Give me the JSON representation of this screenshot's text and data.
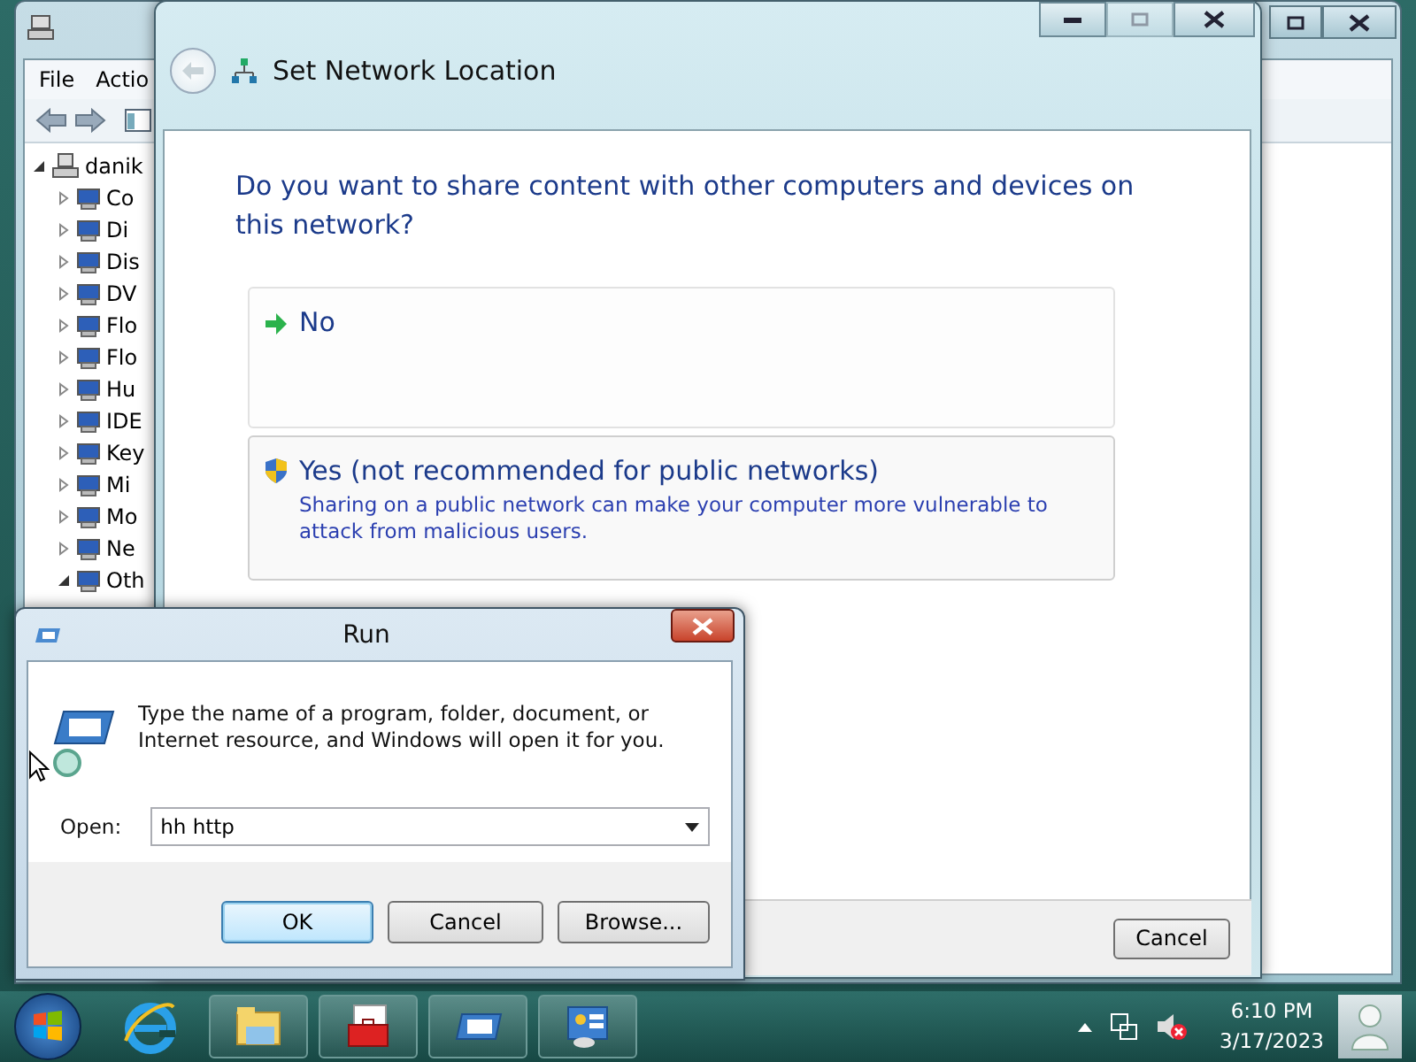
{
  "device_manager": {
    "menu": [
      "File",
      "Actio"
    ],
    "tree": {
      "label": "danik",
      "expanded": true,
      "children": [
        {
          "label": "Co",
          "expanded": false
        },
        {
          "label": "Di",
          "expanded": false
        },
        {
          "label": "Dis",
          "expanded": false
        },
        {
          "label": "DV",
          "expanded": false
        },
        {
          "label": "Flo",
          "expanded": false
        },
        {
          "label": "Flo",
          "expanded": false
        },
        {
          "label": "Hu",
          "expanded": false
        },
        {
          "label": "IDE",
          "expanded": false
        },
        {
          "label": "Key",
          "expanded": false
        },
        {
          "label": "Mi",
          "expanded": false
        },
        {
          "label": "Mo",
          "expanded": false
        },
        {
          "label": "Ne",
          "expanded": false
        },
        {
          "label": "Oth",
          "expanded": true
        }
      ]
    }
  },
  "network_dialog": {
    "title": "Set Network Location",
    "question": "Do you want to share content with other computers and devices on this network?",
    "options": [
      {
        "kind": "arrow",
        "title": "No"
      },
      {
        "kind": "shield",
        "title": "Yes (not recommended for public networks)",
        "description": "Sharing on a public network can make your computer more vulnerable to attack from malicious users."
      }
    ],
    "cancel": "Cancel"
  },
  "run_dialog": {
    "title": "Run",
    "prompt": "Type the name of a program, folder, document, or Internet resource, and Windows will open it for you.",
    "open_label": "Open:",
    "value": "hh http",
    "buttons": [
      {
        "label": "OK",
        "default": true
      },
      {
        "label": "Cancel",
        "default": false
      },
      {
        "label": "Browse...",
        "default": false
      }
    ]
  },
  "taskbar": {
    "time": "6:10 PM",
    "date": "3/17/2023"
  }
}
